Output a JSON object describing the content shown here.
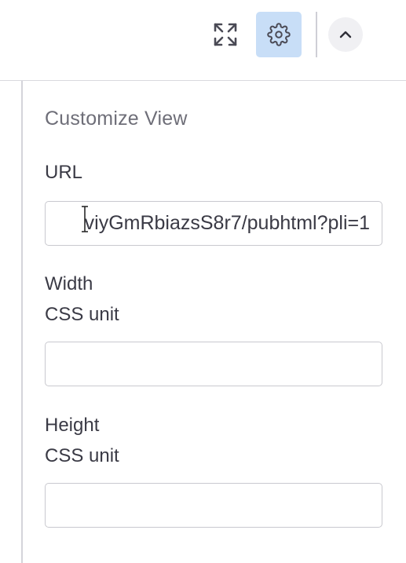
{
  "toolbar": {
    "expand_icon": "expand-arrows-icon",
    "settings_icon": "gear-icon",
    "collapse_icon": "chevron-up-icon",
    "settings_active_color": "#c8def7"
  },
  "panel": {
    "title": "Customize View",
    "url": {
      "label": "URL",
      "value": "viyGmRbiazsS8r7/pubhtml?pli=1"
    },
    "width": {
      "label": "Width",
      "hint": "CSS unit",
      "value": ""
    },
    "height": {
      "label": "Height",
      "hint": "CSS unit",
      "value": ""
    }
  }
}
